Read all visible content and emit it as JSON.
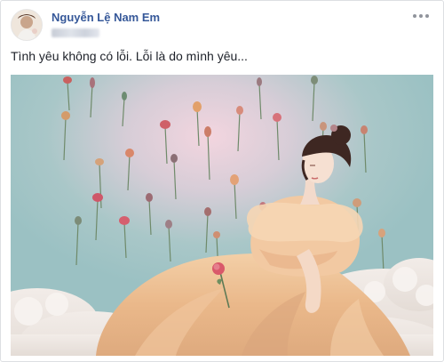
{
  "post": {
    "author": {
      "name": "Nguyễn Lệ Nam Em",
      "avatar_icon": "profile-photo"
    },
    "more_icon": "ellipsis-icon",
    "text": "Tình yêu không có lỗi. Lỗi là do mình yêu...",
    "photo": {
      "subject": "photo-of-woman-in-peach-tulle-gown-seated-before-wall-of-dried-flowers"
    }
  },
  "colors": {
    "author_link": "#365899",
    "text": "#1d2129",
    "wall": "#9fc4c6",
    "gown": "#e9b98a",
    "rose": "#d9586a"
  }
}
